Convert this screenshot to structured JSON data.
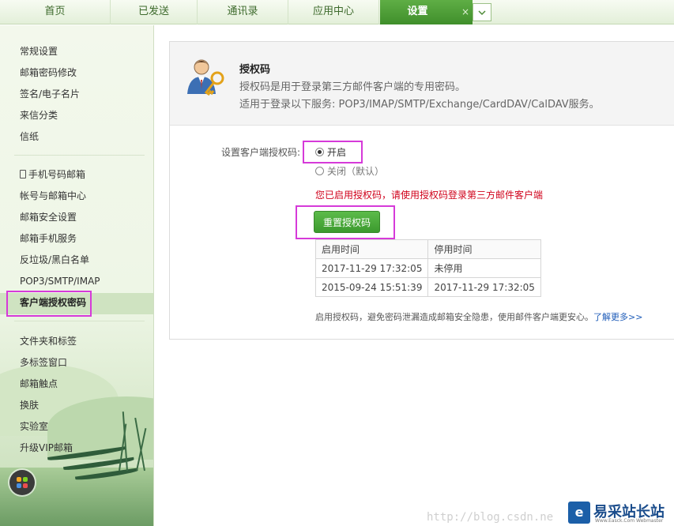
{
  "tabs": [
    {
      "label": "首页"
    },
    {
      "label": "已发送"
    },
    {
      "label": "通讯录"
    },
    {
      "label": "应用中心"
    },
    {
      "label": "设置"
    }
  ],
  "tab_close_icon": "×",
  "tab_more_icon": "chevron-down",
  "sidebar": {
    "group1": [
      "常规设置",
      "邮箱密码修改",
      "签名/电子名片",
      "来信分类",
      "信纸"
    ],
    "group2": [
      "手机号码邮箱",
      "帐号与邮箱中心",
      "邮箱安全设置",
      "邮箱手机服务",
      "反垃圾/黑白名单",
      "POP3/SMTP/IMAP",
      "客户端授权密码"
    ],
    "group3": [
      "文件夹和标签",
      "多标签窗口",
      "邮箱触点",
      "换肤",
      "实验室",
      "升级VIP邮箱"
    ]
  },
  "panel": {
    "title": "授权码",
    "desc1": "授权码是用于登录第三方邮件客户端的专用密码。",
    "desc2": "适用于登录以下服务: POP3/IMAP/SMTP/Exchange/CardDAV/CalDAV服务。"
  },
  "setting": {
    "label": "设置客户端授权码:",
    "option_on": "开启",
    "option_off": "关闭（默认）",
    "warning": "您已启用授权码，请使用授权码登录第三方邮件客户端",
    "reset_button": "重置授权码"
  },
  "history_table": {
    "headers": [
      "启用时间",
      "停用时间"
    ],
    "rows": [
      [
        "2017-11-29 17:32:05",
        "未停用"
      ],
      [
        "2015-09-24 15:51:39",
        "2017-11-29 17:32:05"
      ]
    ]
  },
  "note": {
    "text": "启用授权码，避免密码泄漏造成邮箱安全隐患，使用邮件客户端更安心。",
    "link": "了解更多>>"
  },
  "watermark": "http://blog.csdn.ne",
  "logo": {
    "mark": "e",
    "text": "易采站长站",
    "sub": "Www.Easck.Com Webmaster"
  },
  "colors": {
    "accent": "#3f8f2b",
    "highlight": "#d63ad9",
    "warning": "#d0021b",
    "link": "#1d5bb8"
  }
}
